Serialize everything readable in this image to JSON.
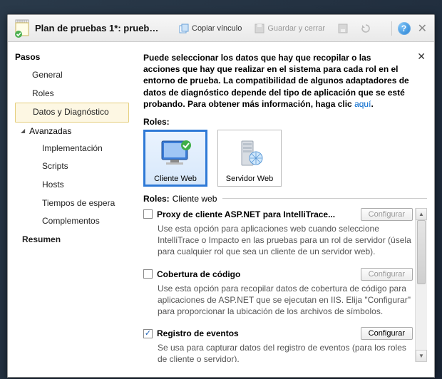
{
  "titlebar": {
    "title": "Plan de pruebas 1*: pruebas...",
    "copy_label": "Copiar vínculo",
    "save_close_label": "Guardar y cerrar"
  },
  "sidebar": {
    "heading": "Pasos",
    "items": {
      "general": "General",
      "roles": "Roles",
      "datos": "Datos y Diagnóstico",
      "avanzadas": "Avanzadas",
      "implementacion": "Implementación",
      "scripts": "Scripts",
      "hosts": "Hosts",
      "tiempos": "Tiempos de espera",
      "complementos": "Complementos",
      "resumen": "Resumen"
    }
  },
  "main": {
    "intro_bold": "Puede seleccionar los datos que hay que recopilar o las acciones que hay que realizar en el sistema para cada rol en el entorno de prueba. La compatibilidad de algunos adaptadores de datos de diagnóstico depende del tipo de aplicación que se esté probando. Para obtener más información, haga clic ",
    "intro_link": "aquí",
    "roles_label": "Roles:",
    "tiles": {
      "client": "Cliente Web",
      "server": "Servidor Web"
    },
    "roles_title_label": "Roles:",
    "roles_title_value": "Cliente web",
    "configure_label": "Configurar",
    "adapters": [
      {
        "checked": false,
        "name": "Proxy de cliente ASP.NET para IntelliTrace...",
        "desc": "Use esta opción para aplicaciones web cuando seleccione IntelliTrace o Impacto en las pruebas para un rol de servidor (úsela para cualquier rol que sea un cliente de un servidor web).",
        "cfg_enabled": false
      },
      {
        "checked": false,
        "name": "Cobertura de código",
        "desc": "Use esta opción para recopilar datos de cobertura de código para aplicaciones de ASP.NET que se ejecutan en IIS. Elija \"Configurar\" para proporcionar la ubicación de los archivos de símbolos.",
        "cfg_enabled": false
      },
      {
        "checked": true,
        "name": "Registro de eventos",
        "desc": "Se usa para capturar datos del registro de eventos (para los roles de cliente o servidor).",
        "cfg_enabled": true
      }
    ]
  }
}
